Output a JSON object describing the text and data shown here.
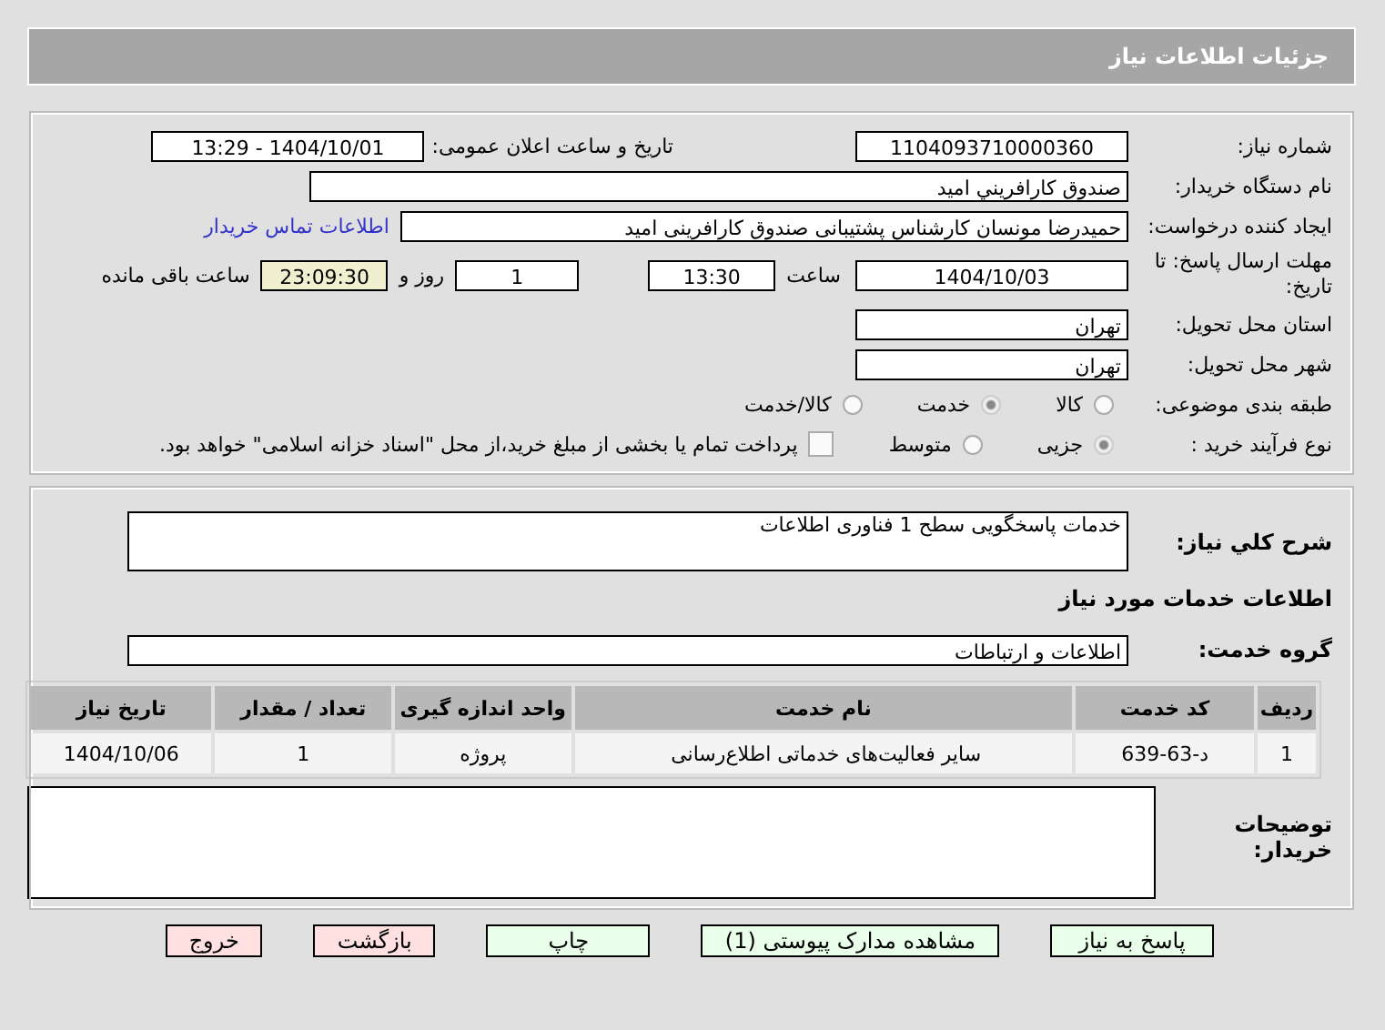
{
  "header": {
    "title": "جزئیات اطلاعات نیاز"
  },
  "details": {
    "need_number": {
      "label": "شماره نیاز:",
      "value": "1104093710000360"
    },
    "announce": {
      "label": "تاریخ و ساعت اعلان عمومی:",
      "value": "1404/10/01 - 13:29"
    },
    "buyer": {
      "label": "نام دستگاه خریدار:",
      "value": "صندوق کارافريني اميد"
    },
    "creator": {
      "label": "ایجاد کننده درخواست:",
      "value": "حمیدرضا مونسان کارشناس پشتیبانی صندوق کارافرینی امید",
      "link": "اطلاعات تماس خریدار"
    },
    "deadline": {
      "label": "مهلت ارسال پاسخ: تا تاریخ:",
      "date": "1404/10/03",
      "time_label": "ساعت",
      "time": "13:30",
      "days": "1",
      "days_label": "روز و",
      "remaining": "23:09:30",
      "remaining_label": "ساعت باقی مانده"
    },
    "province": {
      "label": "استان محل تحویل:",
      "value": "تهران"
    },
    "city": {
      "label": "شهر محل تحویل:",
      "value": "تهران"
    },
    "category": {
      "label": "طبقه بندی موضوعی:",
      "options": [
        {
          "label": "کالا",
          "selected": false,
          "disabled": false
        },
        {
          "label": "خدمت",
          "selected": true,
          "disabled": true
        },
        {
          "label": "کالا/خدمت",
          "selected": false,
          "disabled": false
        }
      ]
    },
    "process": {
      "label": "نوع فرآیند خرید :",
      "options": [
        {
          "label": "جزیی",
          "selected": true,
          "disabled": true
        },
        {
          "label": "متوسط",
          "selected": false,
          "disabled": false
        }
      ],
      "treasury": {
        "label": "پرداخت تمام یا بخشی از مبلغ خرید،از محل \"اسناد خزانه اسلامی\" خواهد بود.",
        "checked": false
      }
    }
  },
  "services": {
    "description": {
      "label": "شرح کلي نياز:",
      "value": "خدمات پاسخگویی سطح 1 فناوری اطلاعات"
    },
    "heading": "اطلاعات خدمات مورد نياز",
    "group": {
      "label": "گروه خدمت:",
      "value": "اطلاعات و ارتباطات"
    },
    "table": {
      "columns": [
        "ردیف",
        "کد خدمت",
        "نام خدمت",
        "واحد اندازه گیری",
        "تعداد / مقدار",
        "تاریخ نیاز"
      ],
      "rows": [
        [
          "1",
          "د-63-639",
          "سایر فعالیت‌های خدماتی اطلاع‌رسانی",
          "پروژه",
          "1",
          "1404/10/06"
        ]
      ]
    },
    "notes": {
      "label": "توضیحات خریدار:"
    }
  },
  "buttons": [
    {
      "label": "پاسخ به نیاز",
      "kind": "action"
    },
    {
      "label": "مشاهده مدارک پیوستی (1)",
      "kind": "action"
    },
    {
      "label": "چاپ",
      "kind": "action"
    },
    {
      "label": "بازگشت",
      "kind": "exit"
    },
    {
      "label": "خروج",
      "kind": "exit"
    }
  ]
}
